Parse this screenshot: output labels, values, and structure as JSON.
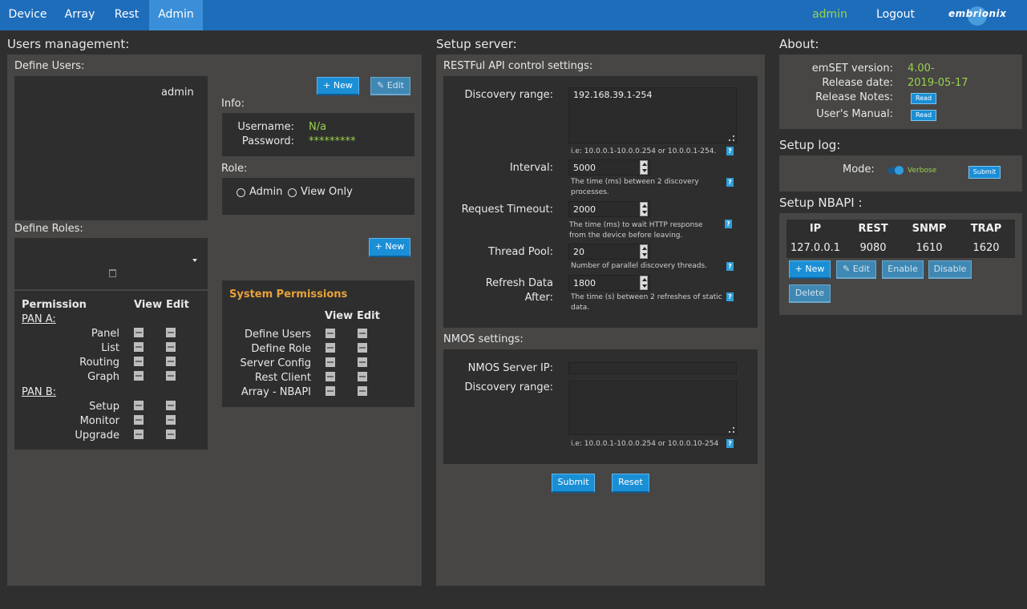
{
  "nav": {
    "tabs": [
      "Device",
      "Array",
      "Rest",
      "Admin"
    ],
    "active_tab": "Admin",
    "user": "admin",
    "logout": "Logout",
    "logo_text": "embrionix"
  },
  "users": {
    "title": "Users management:",
    "define_users": "Define Users:",
    "user_list": [
      "admin"
    ],
    "new_btn": "+ New",
    "edit_btn": "✎ Edit",
    "info_label": "Info:",
    "username_label": "Username:",
    "username_value": "N/a",
    "password_label": "Password:",
    "password_value": "*********",
    "role_label": "Role:",
    "role_options": [
      "Admin",
      "View Only"
    ],
    "define_roles": "Define Roles:",
    "new_role_btn": "+ New",
    "permission_header": "Permission",
    "view_header": "View",
    "edit_header": "Edit",
    "pan_a": "PAN A:",
    "pan_a_items": [
      "Panel",
      "List",
      "Routing",
      "Graph"
    ],
    "pan_b": "PAN B:",
    "pan_b_items": [
      "Setup",
      "Monitor",
      "Upgrade"
    ],
    "system_permissions": "System Permissions",
    "sys_items": [
      "Define Users",
      "Define Role",
      "Server Config",
      "Rest Client",
      "Array - NBAPI"
    ]
  },
  "server": {
    "title": "Setup server:",
    "restful_title": "RESTFul API control settings:",
    "discovery_label": "Discovery range:",
    "discovery_value": "192.168.39.1-254",
    "discovery_help": "i.e: 10.0.0.1-10.0.0.254 or 10.0.0.1-254.",
    "interval_label": "Interval:",
    "interval_value": "5000",
    "interval_help": "The time (ms) between 2 discovery processes.",
    "timeout_label": "Request Timeout:",
    "timeout_value": "2000",
    "timeout_help": "The time (ms) to wait HTTP response from the device before leaving.",
    "thread_label": "Thread Pool:",
    "thread_value": "20",
    "thread_help": "Number of parallel discovery threads.",
    "refresh_label1": "Refresh Data",
    "refresh_label2": "After:",
    "refresh_value": "1800",
    "refresh_help": "The time (s) between 2 refreshes of static data.",
    "nmos_title": "NMOS settings:",
    "nmos_ip_label": "NMOS Server IP:",
    "nmos_ip_value": "",
    "nmos_discovery_label": "Discovery range:",
    "nmos_discovery_value": "",
    "nmos_help": "i.e: 10.0.0.1-10.0.0.254 or 10.0.0.10-254",
    "submit": "Submit",
    "reset": "Reset",
    "help_icon": "?"
  },
  "about": {
    "title": "About:",
    "version_label": "emSET version:",
    "version_value": "4.00-",
    "release_label": "Release date:",
    "release_value": "2019-05-17",
    "notes_label": "Release Notes:",
    "manual_label": "User's Manual:",
    "read": "Read"
  },
  "log": {
    "title": "Setup log:",
    "mode_label": "Mode:",
    "mode_value": "Verbose",
    "submit": "Submit"
  },
  "nbapi": {
    "title": "Setup NBAPI :",
    "headers": [
      "IP",
      "REST",
      "SNMP",
      "TRAP"
    ],
    "row": [
      "127.0.0.1",
      "9080",
      "1610",
      "1620"
    ],
    "new": "+ New",
    "edit": "✎ Edit",
    "enable": "Enable",
    "disable": "Disable",
    "delete": "Delete"
  },
  "colors": {
    "nav_bg": "#1e6dbb",
    "active_tab": "#3a8fd8",
    "accent_green": "#9ad24a",
    "button_blue": "#1a8fd6",
    "section_title_orange": "#e8a23a"
  }
}
